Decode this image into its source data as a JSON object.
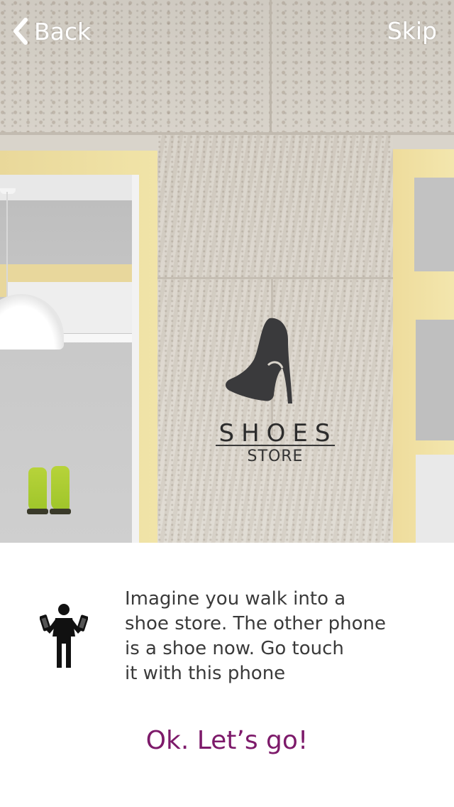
{
  "nav": {
    "back_label": "Back",
    "skip_label": "Skip",
    "color": "#ffffff"
  },
  "hero": {
    "logo_title": "SHOES",
    "logo_subtitle": "STORE",
    "logo_icon": "high-heel-icon"
  },
  "instruction": {
    "icon": "person-holding-phones-icon",
    "text": "Imagine you walk into a\nshoe store. The other phone\nis a shoe now. Go touch\nit with this phone"
  },
  "cta": {
    "label": "Ok. Let’s go!",
    "color": "#7d1a6a"
  }
}
